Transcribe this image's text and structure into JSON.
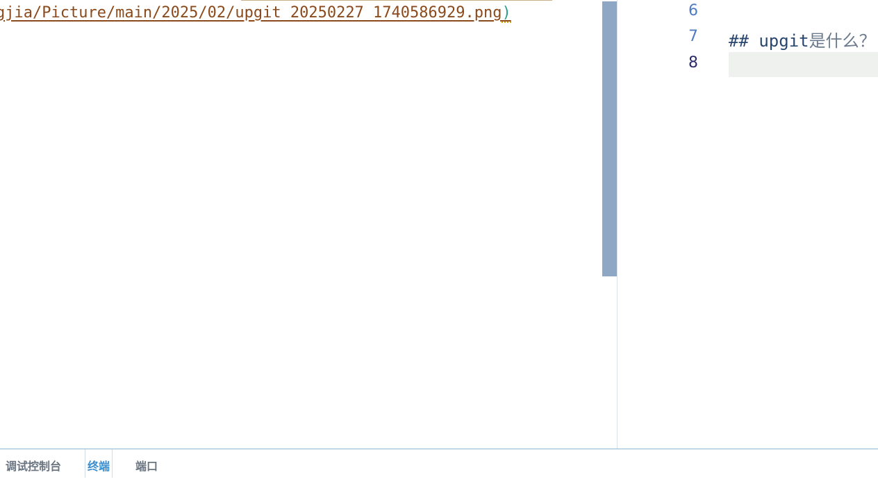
{
  "editor_left": {
    "code_text": "gjia/Picture/main/2025/02/upgit_20250227_1740586929.png",
    "close_paren": ")"
  },
  "editor_right": {
    "lines": [
      {
        "num": "6",
        "text": ""
      },
      {
        "num": "7",
        "text_prefix": "## upgit",
        "text_cjk": "是什么？"
      },
      {
        "num": "8",
        "text": ""
      }
    ]
  },
  "panel": {
    "tabs": [
      {
        "label": "调试控制台"
      },
      {
        "label": "终端"
      },
      {
        "label": "端口"
      }
    ],
    "active_tab": "终端"
  },
  "colors": {
    "link_text": "#8a4a1c",
    "scroll_thumb": "#8ea7c4",
    "active_tab": "#3c8fd0",
    "line_number": "#4f7bc2"
  }
}
